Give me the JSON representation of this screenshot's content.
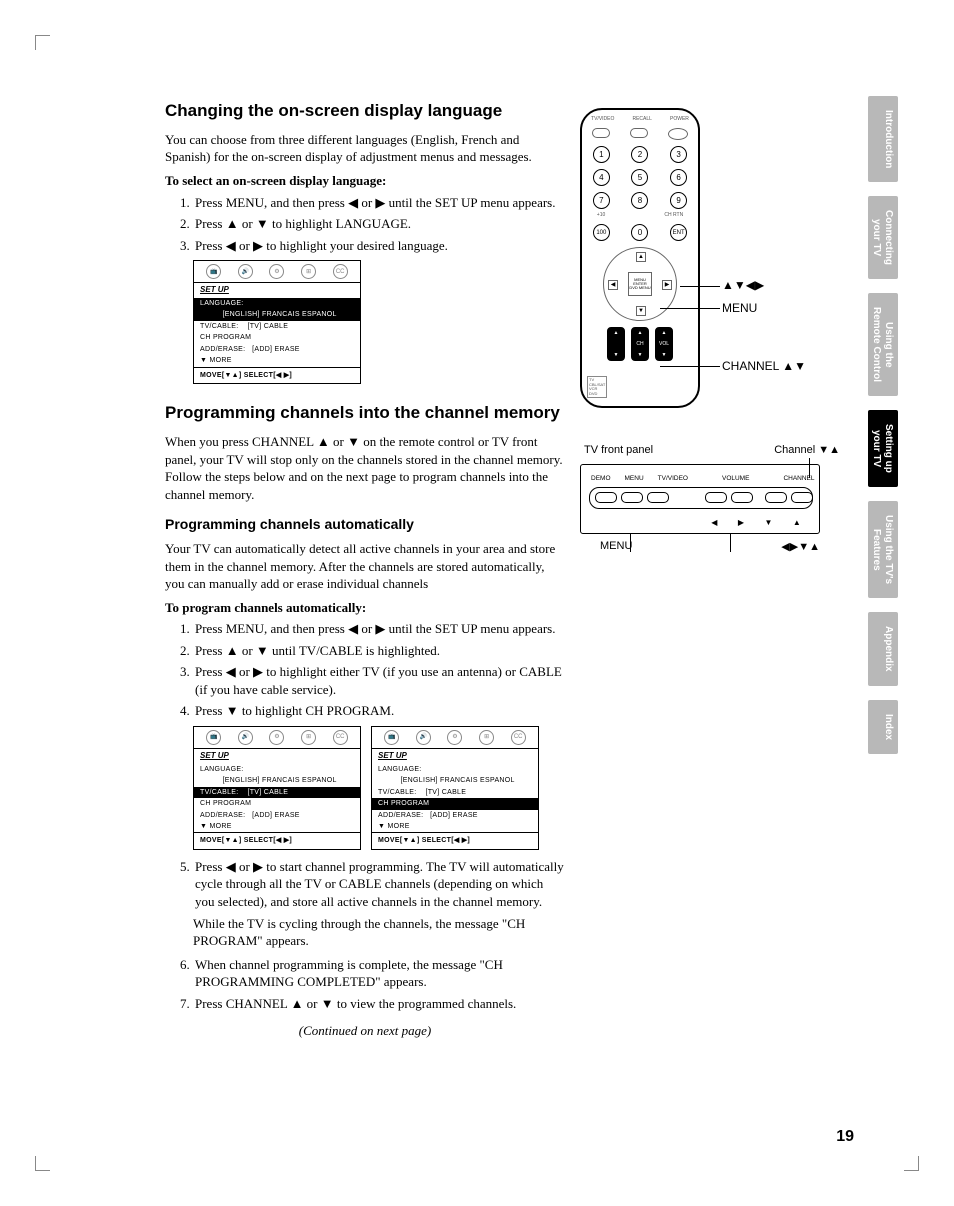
{
  "page_number": "19",
  "side_tabs": [
    "Introduction",
    "Connecting\nyour TV",
    "Using the\nRemote Control",
    "Setting up\nyour TV",
    "Using the TV's\nFeatures",
    "Appendix",
    "Index"
  ],
  "section1": {
    "title": "Changing the on-screen display language",
    "intro": "You can choose from three different languages (English, French and Spanish) for the on-screen display of adjustment menus and messages.",
    "lead": "To select an on-screen display language:",
    "steps": [
      "Press MENU, and then press ◀ or ▶ until the SET UP menu appears.",
      "Press ▲ or ▼ to highlight LANGUAGE.",
      "Press ◀ or ▶ to highlight your desired language."
    ]
  },
  "osd1": {
    "title": "SET UP",
    "lines": [
      {
        "t": "LANGUAGE:",
        "hl": true
      },
      {
        "t": "          [ENGLISH] FRANCAIS ESPANOL",
        "hl": true
      },
      {
        "t": "TV/CABLE:    [TV] CABLE"
      },
      {
        "t": "CH PROGRAM"
      },
      {
        "t": "ADD/ERASE:   [ADD] ERASE"
      },
      {
        "t": "▼ MORE"
      }
    ],
    "footer": "MOVE[▼▲]   SELECT[◀ ▶]"
  },
  "section2": {
    "title": "Programming channels into the channel memory",
    "intro": "When you press CHANNEL ▲ or ▼ on the remote control or TV front panel, your TV will stop only on the channels stored in the channel memory. Follow the steps below and on the next page to program channels into the channel memory.",
    "subtitle": "Programming channels automatically",
    "subintro": "Your TV can automatically detect all active channels in your area and store them in the channel memory. After the channels are stored automatically, you can manually add or erase individual channels",
    "lead": "To program channels automatically:",
    "steps_a": [
      "Press MENU, and then press ◀ or ▶ until the SET UP menu appears.",
      "Press ▲ or ▼ until TV/CABLE is highlighted.",
      "Press ◀ or ▶ to highlight either TV (if you use an antenna) or CABLE (if you have cable service).",
      "Press ▼ to highlight CH PROGRAM."
    ],
    "steps_b": [
      "Press ◀ or ▶ to start channel programming. The TV will automatically cycle through all the TV or CABLE channels (depending on which you selected), and store all active channels in the channel memory.",
      "When channel programming is complete, the message \"CH PROGRAMMING COMPLETED\" appears.",
      "Press CHANNEL ▲ or ▼ to view the programmed channels."
    ],
    "note5": "While the TV is cycling through the channels, the message \"CH PROGRAM\" appears.",
    "continued": "(Continued on next page)"
  },
  "osd2": {
    "title": "SET UP",
    "lines": [
      {
        "t": "LANGUAGE:"
      },
      {
        "t": "          [ENGLISH] FRANCAIS ESPANOL"
      },
      {
        "t": "TV/CABLE:    [TV] CABLE",
        "hl": true
      },
      {
        "t": "CH PROGRAM"
      },
      {
        "t": "ADD/ERASE:   [ADD] ERASE"
      },
      {
        "t": "▼ MORE"
      }
    ],
    "footer": "MOVE[▼▲]   SELECT[◀ ▶]"
  },
  "osd3": {
    "title": "SET UP",
    "lines": [
      {
        "t": "LANGUAGE:"
      },
      {
        "t": "          [ENGLISH] FRANCAIS ESPANOL"
      },
      {
        "t": "TV/CABLE:    [TV] CABLE"
      },
      {
        "t": "CH PROGRAM",
        "hl": true
      },
      {
        "t": "ADD/ERASE:   [ADD] ERASE"
      },
      {
        "t": "▼ MORE"
      }
    ],
    "footer": "MOVE[▼▲]   SELECT[◀ ▶]"
  },
  "remote": {
    "top_labels": [
      "TV/VIDEO",
      "RECALL",
      "POWER"
    ],
    "numbers": [
      "1",
      "2",
      "3",
      "4",
      "5",
      "6",
      "7",
      "8",
      "9",
      "100",
      "0",
      "ENT"
    ],
    "sub_labels": [
      "+10",
      "",
      "CH RTN"
    ],
    "dpad_center": "MENU\nENTER\nDVD MENU",
    "ch": "CH",
    "vol": "VOL",
    "switch": "TV\nCBL/SAT\nVCR\nDVD",
    "callout_arrows": "▲▼◀▶",
    "callout_menu": "MENU",
    "callout_channel": "CHANNEL ▲▼"
  },
  "front_panel": {
    "caption_top": "TV front panel",
    "caption_right": "Channel ▼▲",
    "labels": [
      "DEMO",
      "MENU",
      "TV/VIDEO",
      "VOLUME",
      "CHANNEL"
    ],
    "bottom_left": "MENU",
    "bottom_right": "◀▶▼▲"
  }
}
